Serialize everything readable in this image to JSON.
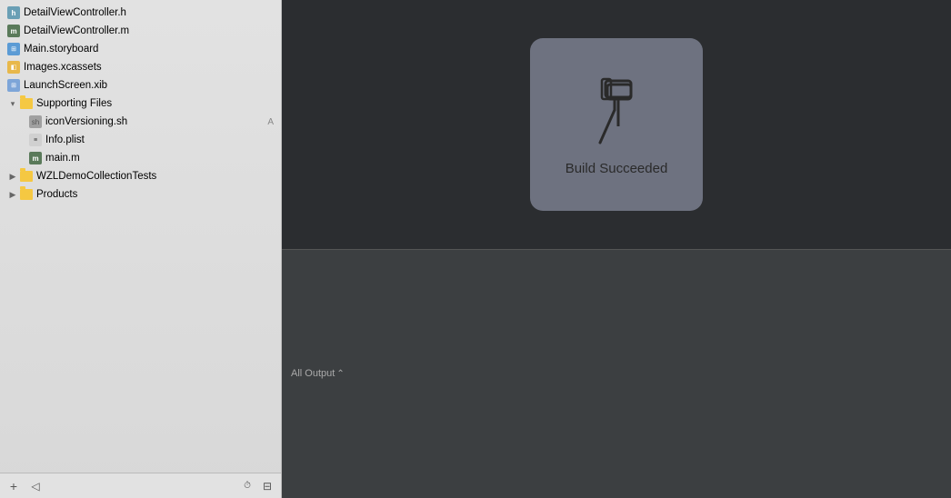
{
  "sidebar": {
    "items": [
      {
        "id": "detail-h",
        "label": "DetailViewController.h",
        "type": "h",
        "indent": "pl-8",
        "badge": ""
      },
      {
        "id": "detail-m",
        "label": "DetailViewController.m",
        "type": "m",
        "indent": "pl-8",
        "badge": ""
      },
      {
        "id": "main-storyboard",
        "label": "Main.storyboard",
        "type": "storyboard",
        "indent": "pl-8",
        "badge": ""
      },
      {
        "id": "images-assets",
        "label": "Images.xcassets",
        "type": "assets",
        "indent": "pl-8",
        "badge": ""
      },
      {
        "id": "launchscreen-xib",
        "label": "LaunchScreen.xib",
        "type": "xib",
        "indent": "pl-8",
        "badge": ""
      },
      {
        "id": "supporting-files",
        "label": "Supporting Files",
        "type": "folder",
        "indent": "pl-8",
        "badge": "",
        "disclosure": "▾"
      },
      {
        "id": "icon-versioning",
        "label": "iconVersioning.sh",
        "type": "generic",
        "indent": "pl-20",
        "badge": "A"
      },
      {
        "id": "info-plist",
        "label": "Info.plist",
        "type": "generic",
        "indent": "pl-20",
        "badge": ""
      },
      {
        "id": "main-m",
        "label": "main.m",
        "type": "m",
        "indent": "pl-20",
        "badge": ""
      },
      {
        "id": "wzl-tests",
        "label": "WZLDemoCollectionTests",
        "type": "folder",
        "indent": "pl-8",
        "badge": "",
        "disclosure": "▶"
      },
      {
        "id": "products",
        "label": "Products",
        "type": "folder",
        "indent": "pl-8",
        "badge": "",
        "disclosure": "▶"
      }
    ]
  },
  "editor": {
    "build_notification": {
      "text": "Build Succeeded"
    }
  },
  "bottom_toolbar": {
    "output_label": "All Output",
    "chevron": "⌃"
  },
  "icons": {
    "h": "h",
    "m": "m",
    "storyboard": "⊞",
    "assets": "□",
    "xib": "⊞",
    "folder": "📁",
    "generic": "≡",
    "add": "+",
    "timer": "⏱",
    "split": "⊟",
    "plus": "+"
  }
}
